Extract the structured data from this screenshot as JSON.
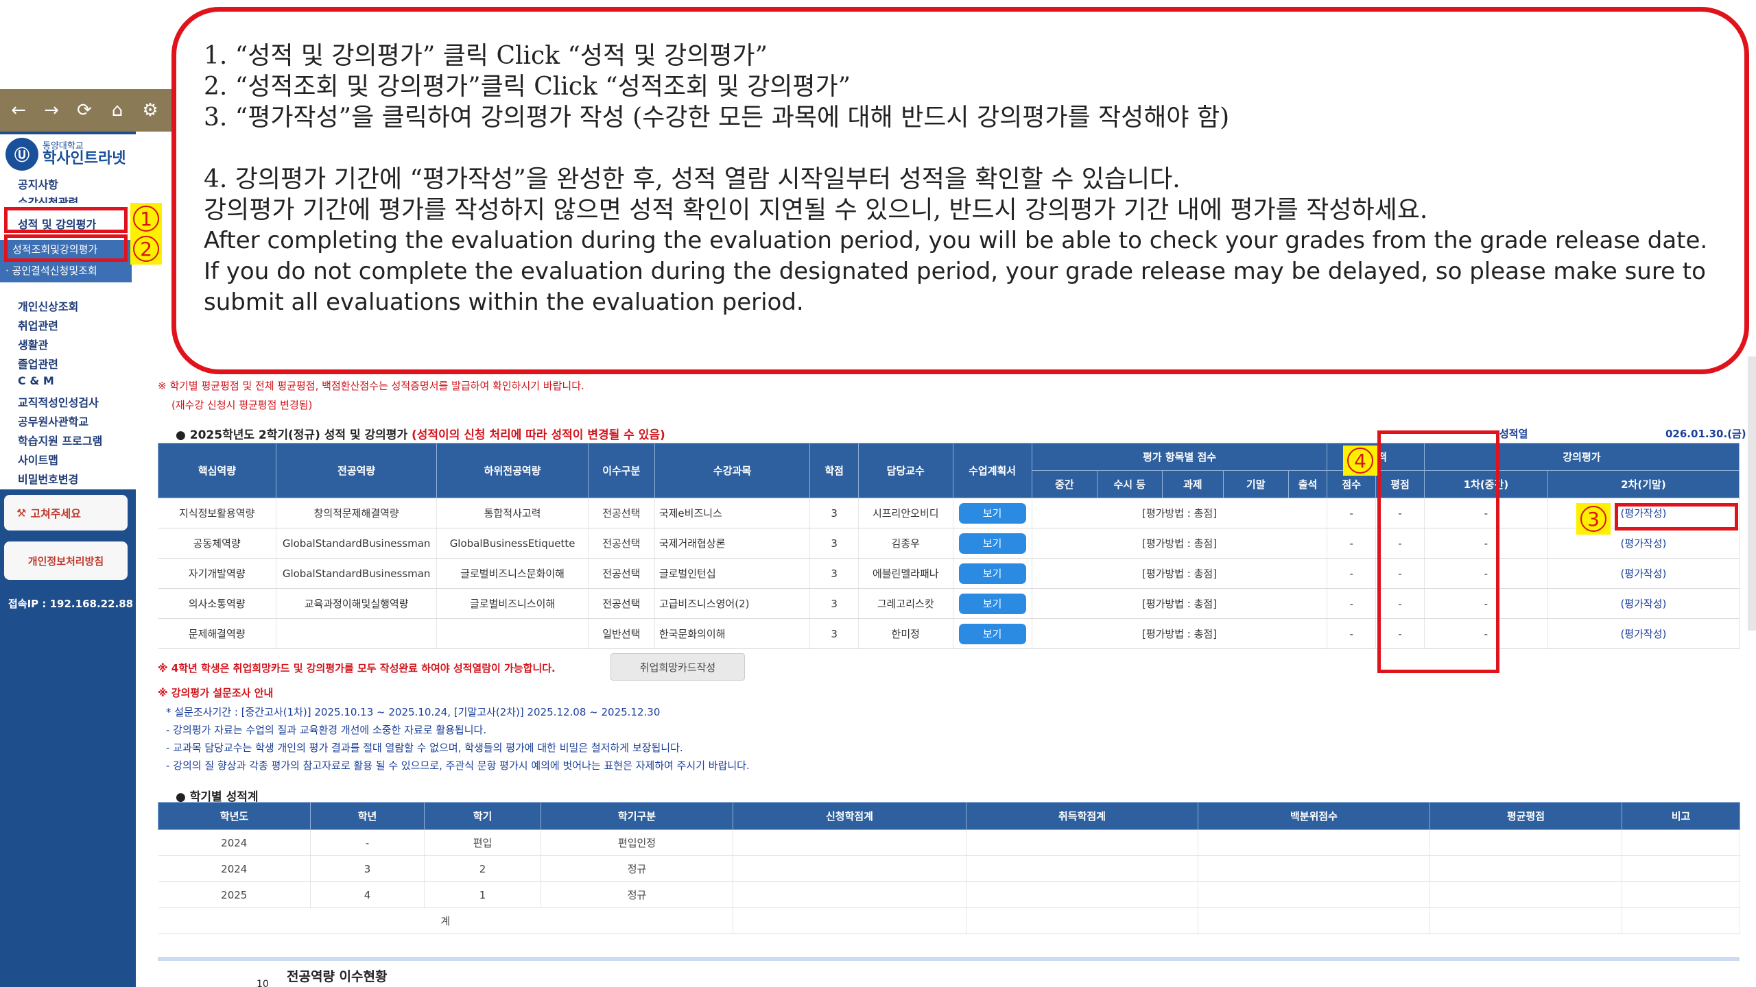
{
  "browser": {
    "icons": [
      "back-arrow-icon",
      "forward-arrow-icon",
      "reload-icon",
      "home-icon",
      "site-settings-icon"
    ],
    "glyphs": [
      "←",
      "→",
      "⟳",
      "⌂",
      "⚙"
    ]
  },
  "sidebar": {
    "logo_small": "동양대학교",
    "logo_big": "학사인트라넷",
    "logo_mark": "Ⓤ",
    "items": [
      {
        "label": "공지사항"
      },
      {
        "label": "수강신청관련"
      },
      {
        "label": "성적 및 강의평가"
      },
      {
        "label": "성적조회및강의평가"
      },
      {
        "label": "· 공인결석신청및조회"
      },
      {
        "label": "개인신상조회"
      },
      {
        "label": "취업관련"
      },
      {
        "label": "생활관"
      },
      {
        "label": "졸업관련"
      },
      {
        "label": "C & M"
      },
      {
        "label": "교직적성인성검사"
      },
      {
        "label": "공무원사관학교"
      },
      {
        "label": "학습지원 프로그램"
      },
      {
        "label": "사이트맵"
      },
      {
        "label": "비밀번호변경"
      }
    ],
    "fix_button": "고쳐주세요",
    "fix_icon": "⚒",
    "privacy_button": "개인정보처리방침",
    "ip_label": "접속IP : 192.168.22.88"
  },
  "markers": {
    "m1": "1",
    "m2": "2",
    "m3": "3",
    "m4": "4"
  },
  "callout": {
    "line1": "1. “성적 및 강의평가” 클릭   Click “성적 및 강의평가”",
    "line2": "2. “성적조회 및 강의평가”클릭 Click “성적조회 및 강의평가”",
    "line3": "3. “평가작성”을 클릭하여 강의평가 작성 (수강한 모든 과목에 대해 반드시 강의평가를 작성해야 함)",
    "line4": "4. 강의평가 기간에 “평가작성”을 완성한 후, 성적 열람 시작일부터 성적을 확인할 수 있습니다.",
    "line5": "   강의평가 기간에 평가를 작성하지 않으면 성적 확인이 지연될 수 있으니, 반드시 강의평가 기간 내에 평가를 작성하세요.",
    "line6": "   After completing the evaluation during the evaluation period, you will be able to check your grades from the grade release date.",
    "line7": "   If you do not complete the evaluation during the designated period, your grade release may be delayed, so please make sure to submit all evaluations within the evaluation period."
  },
  "notes": {
    "n1": "※ 학기별 평균평점 및 전체 평균평점, 백점환산점수는 성적증명서를 발급하여 확인하시기 바랍니다.",
    "n2": "(재수강 신청시 평균평점 변경됨)",
    "section1_title": "● 2025학년도 2학기(정규) 성적 및 강의평가",
    "section1_warn": "(성적이의 신청 처리에 따라 성적이 변경될 수 있음)",
    "right_label": "성적열",
    "right_date": "026.01.30.(금)"
  },
  "grades": {
    "headers": {
      "core": "핵심역량",
      "major": "전공역량",
      "sub": "하위전공역량",
      "type": "이수구분",
      "course": "수강과목",
      "credit": "학점",
      "prof": "담당교수",
      "plan": "수업계획서",
      "score_group": "평가 항목별 점수",
      "mid": "중간",
      "quiz": "수시 등",
      "hw": "과제",
      "final": "기말",
      "attend": "출석",
      "grade_group": "성 적",
      "score": "점수",
      "gpa": "평점",
      "eval_group": "강의평가",
      "eval1": "1차(중간)",
      "eval2": "2차(기말)"
    },
    "rows": [
      {
        "core": "지식정보활용역량",
        "major": "창의적문제해결역량",
        "sub": "통합적사고력",
        "type": "전공선택",
        "course": "국제e비즈니스",
        "credit": "3",
        "prof": "시프리안오비디",
        "plan": "보기",
        "method": "[평가방법 : 총점]",
        "score": "-",
        "gpa": "-",
        "eval1": "-",
        "eval2": "(평가작성)"
      },
      {
        "core": "공동체역량",
        "major": "GlobalStandardBusinessman",
        "sub": "GlobalBusinessEtiquette",
        "type": "전공선택",
        "course": "국제거래협상론",
        "credit": "3",
        "prof": "김종우",
        "plan": "보기",
        "method": "[평가방법 : 총점]",
        "score": "-",
        "gpa": "-",
        "eval1": "-",
        "eval2": "(평가작성)"
      },
      {
        "core": "자기개발역량",
        "major": "GlobalStandardBusinessman",
        "sub": "글로벌비즈니스문화이해",
        "type": "전공선택",
        "course": "글로벌인턴십",
        "credit": "3",
        "prof": "에블린멜라패나",
        "plan": "보기",
        "method": "[평가방법 : 총점]",
        "score": "-",
        "gpa": "-",
        "eval1": "-",
        "eval2": "(평가작성)"
      },
      {
        "core": "의사소통역량",
        "major": "교육과정이해및실행역량",
        "sub": "글로벌비즈니스이해",
        "type": "전공선택",
        "course": "고급비즈니스영어(2)",
        "credit": "3",
        "prof": "그레고리스캇",
        "plan": "보기",
        "method": "[평가방법 : 총점]",
        "score": "-",
        "gpa": "-",
        "eval1": "-",
        "eval2": "(평가작성)"
      },
      {
        "core": "문제해결역량",
        "major": "",
        "sub": "",
        "type": "일반선택",
        "course": "한국문화의이해",
        "credit": "3",
        "prof": "한미정",
        "plan": "보기",
        "method": "[평가방법 : 총점]",
        "score": "-",
        "gpa": "-",
        "eval1": "-",
        "eval2": "(평가작성)"
      }
    ]
  },
  "after": {
    "warn4": "※ 4학년 학생은 취업희망카드 및 강의평가를 모두 작성완료 하여야 성적열람이 가능합니다.",
    "card_button": "취업희망카드작성",
    "survey_title": "※ 강의평가 설문조사 안내",
    "survey_period": "* 설문조사기간 : [중간고사(1차)] 2025.10.13 ~ 2025.10.24,      [기말고사(2차)] 2025.12.08 ~ 2025.12.30",
    "s1": "- 강의평가 자료는 수업의 질과 교육환경 개선에 소중한 자료로 활용됩니다.",
    "s2": "- 교과목 담당교수는 학생 개인의 평가 결과를 절대 열람할 수 없으며, 학생들의 평가에 대한 비밀은 철저하게 보장됩니다.",
    "s3": "- 강의의 질 향상과 각종 평가의 참고자료로 활용 될 수 있으므로, 주관식 문항 평가시 예의에 벗어나는 표현은 자제하여 주시기 바랍니다.",
    "sem_title": "● 학기별 성적계",
    "bottom_title": "전공역량 이수현황",
    "bottom_num": "10"
  },
  "sem": {
    "headers": [
      "학년도",
      "학년",
      "학기",
      "학기구분",
      "신청학점계",
      "취득학점계",
      "백분위점수",
      "평균평점",
      "비고"
    ],
    "rows": [
      [
        "2024",
        "-",
        "편입",
        "편입인정",
        "",
        "",
        "",
        "",
        ""
      ],
      [
        "2024",
        "3",
        "2",
        "정규",
        "",
        "",
        "",
        "",
        ""
      ],
      [
        "2025",
        "4",
        "1",
        "정규",
        "",
        "",
        "",
        "",
        ""
      ]
    ],
    "total_label": "계"
  },
  "colors": {
    "header": "#2e5f9e",
    "annotation": "#e0121b",
    "highlight": "#ffef00",
    "link": "#1a3f9a"
  }
}
